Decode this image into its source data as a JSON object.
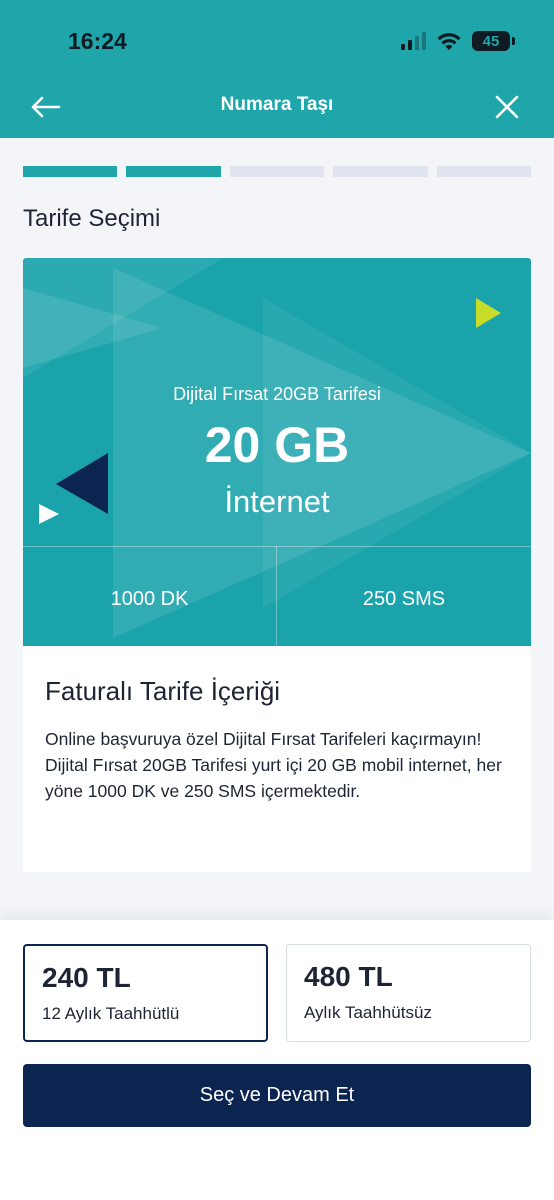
{
  "status_bar": {
    "time": "16:24",
    "battery": "45"
  },
  "nav": {
    "title": "Numara Taşı"
  },
  "progress": {
    "total_steps": 5,
    "completed_steps": 2
  },
  "section_title": "Tarife Seçimi",
  "tariff": {
    "name": "Dijital Fırsat 20GB Tarifesi",
    "data_amount": "20 GB",
    "data_label": "İnternet",
    "minutes": "1000 DK",
    "sms": "250 SMS"
  },
  "content": {
    "title": "Faturalı Tarife İçeriği",
    "description": "Online başvuruya özel  Dijital Fırsat Tarifeleri kaçırmayın! Dijital Fırsat 20GB Tarifesi yurt içi 20 GB mobil internet, her yöne 1000 DK ve 250 SMS içermektedir."
  },
  "pricing": {
    "options": [
      {
        "price": "240 TL",
        "label": "12 Aylık Taahhütlü",
        "selected": true
      },
      {
        "price": "480 TL",
        "label": "Aylık Taahhütsüz",
        "selected": false
      }
    ]
  },
  "cta_label": "Seç ve Devam Et",
  "colors": {
    "brand_teal": "#1fa6ab",
    "navy": "#0b2550",
    "accent_lime": "#c8dc2a",
    "inactive_step": "#dfe4ee"
  },
  "icons": {
    "back": "arrow-left-icon",
    "close": "close-icon",
    "signal": "signal-icon",
    "wifi": "wifi-icon",
    "battery": "battery-icon"
  }
}
